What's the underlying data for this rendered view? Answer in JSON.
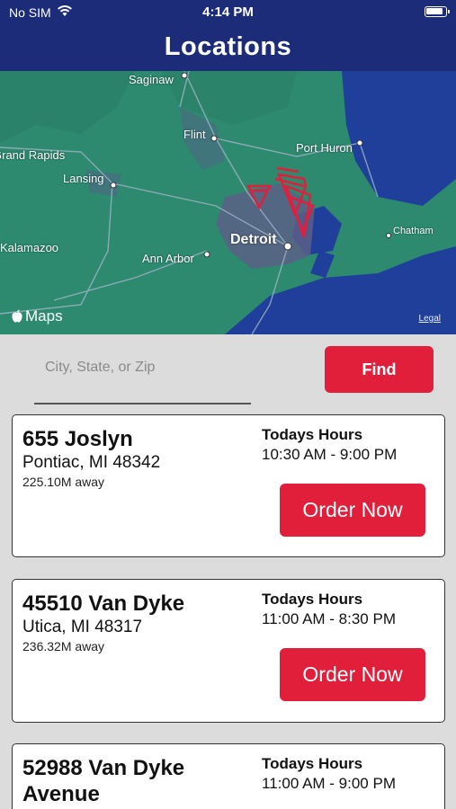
{
  "status_bar": {
    "carrier": "No SIM",
    "time": "4:14 PM"
  },
  "header": {
    "title": "Locations"
  },
  "map": {
    "labels": [
      "Saginaw",
      "Flint",
      "Port Huron",
      "Grand Rapids",
      "Lansing",
      "Detroit",
      "Chatham",
      "Kalamazoo",
      "Ann Arbor"
    ],
    "attribution": "Maps",
    "legal": "Legal",
    "colors": {
      "land": "#2d8a6f",
      "urban": "#5a5f86",
      "water": "#1f3f9a",
      "pin": "#e21f3b"
    }
  },
  "search": {
    "placeholder": "City, State, or Zip",
    "value": "",
    "find_label": "Find"
  },
  "locations": [
    {
      "street": "655 Joslyn",
      "city": "Pontiac, MI 48342",
      "distance": "225.10M away",
      "hours_label": "Todays Hours",
      "hours": "10:30 AM - 9:00 PM",
      "order_label": "Order Now"
    },
    {
      "street": "45510 Van Dyke",
      "city": "Utica, MI 48317",
      "distance": "236.32M away",
      "hours_label": "Todays Hours",
      "hours": "11:00 AM - 8:30 PM",
      "order_label": "Order Now"
    },
    {
      "street": "52988 Van Dyke Avenue",
      "hours_label": "Todays Hours",
      "hours": "11:00 AM - 9:00 PM"
    }
  ]
}
